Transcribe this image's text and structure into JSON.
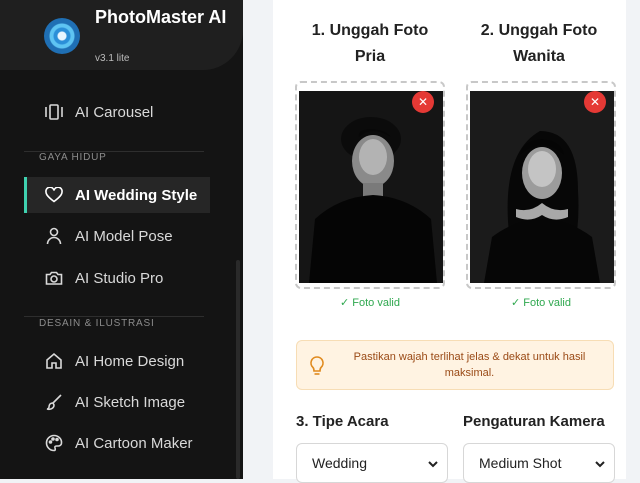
{
  "brand": {
    "name": "PhotoMaster AI",
    "version": "v3.1 lite"
  },
  "sidebar": {
    "items_top": [
      {
        "label": "AI Carousel",
        "icon": "carousel-icon"
      }
    ],
    "section_lifestyle": "GAYA HIDUP",
    "items_lifestyle": [
      {
        "label": "AI Wedding Style",
        "icon": "heart-icon",
        "active": true
      },
      {
        "label": "AI Model Pose",
        "icon": "user-icon"
      },
      {
        "label": "AI Studio Pro",
        "icon": "camera-icon"
      }
    ],
    "section_design": "DESAIN & ILUSTRASI",
    "items_design": [
      {
        "label": "AI Home Design",
        "icon": "home-icon"
      },
      {
        "label": "AI Sketch Image",
        "icon": "brush-icon"
      },
      {
        "label": "AI Cartoon Maker",
        "icon": "palette-icon"
      }
    ]
  },
  "upload": {
    "male_title": "1. Unggah Foto Pria",
    "female_title": "2. Unggah Foto Wanita",
    "male_status": "✓ Foto valid",
    "female_status": "✓ Foto valid",
    "remove_symbol": "✕"
  },
  "alert": {
    "text": "Pastikan wajah terlihat jelas & dekat untuk hasil maksimal.",
    "icon": "lightbulb-icon"
  },
  "event": {
    "label": "3. Tipe Acara",
    "value": "Wedding"
  },
  "camera": {
    "label": "Pengaturan Kamera",
    "value": "Medium Shot"
  },
  "colors": {
    "accent": "#3fd1b0",
    "sidebar_bg": "#141414",
    "valid": "#2fa84f",
    "remove": "#e53935",
    "alert_bg": "#fff3e2",
    "alert_text": "#9a4a16"
  }
}
